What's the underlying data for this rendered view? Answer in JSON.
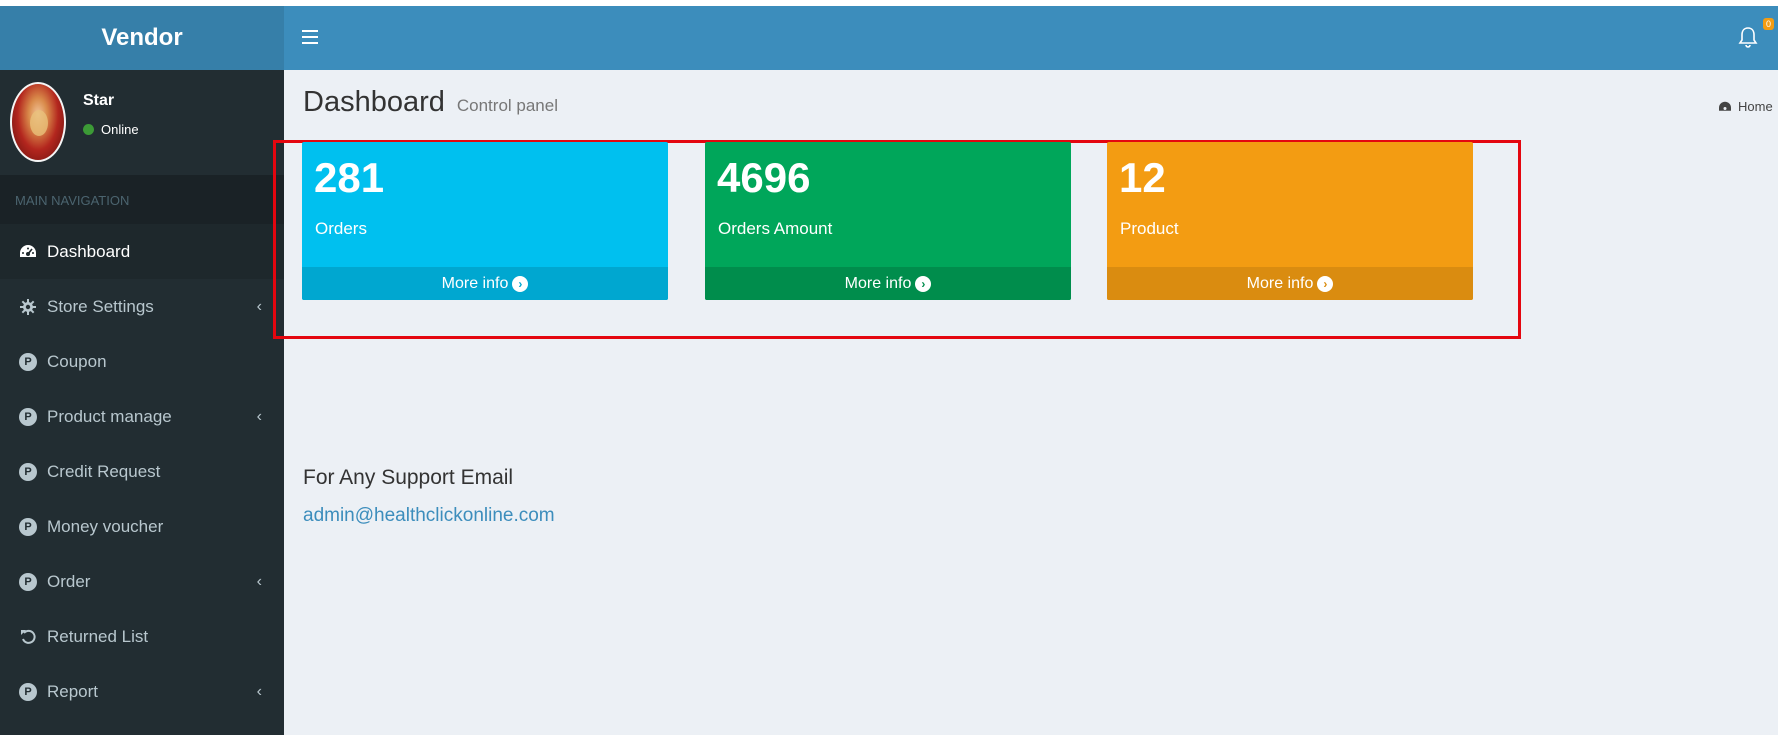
{
  "app": {
    "brand": "Vendor"
  },
  "user": {
    "name": "Star",
    "status": "Online"
  },
  "sidebar": {
    "header": "MAIN NAVIGATION",
    "items": [
      {
        "label": "Dashboard",
        "icon": "dashboard-icon",
        "active": true,
        "has_submenu": false
      },
      {
        "label": "Store Settings",
        "icon": "gear-icon",
        "has_submenu": true
      },
      {
        "label": "Coupon",
        "icon": "p-circle-icon",
        "has_submenu": false
      },
      {
        "label": "Product manage",
        "icon": "p-circle-icon",
        "has_submenu": true
      },
      {
        "label": "Credit Request",
        "icon": "p-circle-icon",
        "has_submenu": false
      },
      {
        "label": "Money voucher",
        "icon": "p-circle-icon",
        "has_submenu": false
      },
      {
        "label": "Order",
        "icon": "p-circle-icon",
        "has_submenu": true
      },
      {
        "label": "Returned List",
        "icon": "undo-icon",
        "has_submenu": false
      },
      {
        "label": "Report",
        "icon": "p-circle-icon",
        "has_submenu": true
      }
    ],
    "p_icon_letter": "P",
    "chevron": "‹"
  },
  "header": {
    "notification_count": "0"
  },
  "page": {
    "title": "Dashboard",
    "subtitle": "Control panel",
    "breadcrumb": "Home"
  },
  "stats": [
    {
      "value": "281",
      "label": "Orders",
      "more": "More info",
      "color": "#00c0ef"
    },
    {
      "value": "4696",
      "label": "Orders Amount",
      "more": "More info",
      "color": "#00a65a"
    },
    {
      "value": "12",
      "label": "Product",
      "more": "More info",
      "color": "#f39c12"
    }
  ],
  "support": {
    "title": "For Any Support Email",
    "email": "admin@healthclickonline.com"
  },
  "colors": {
    "header": "#3c8dbc",
    "logo": "#367fa9",
    "sidebar": "#222d32",
    "highlight": "#e4060f"
  }
}
